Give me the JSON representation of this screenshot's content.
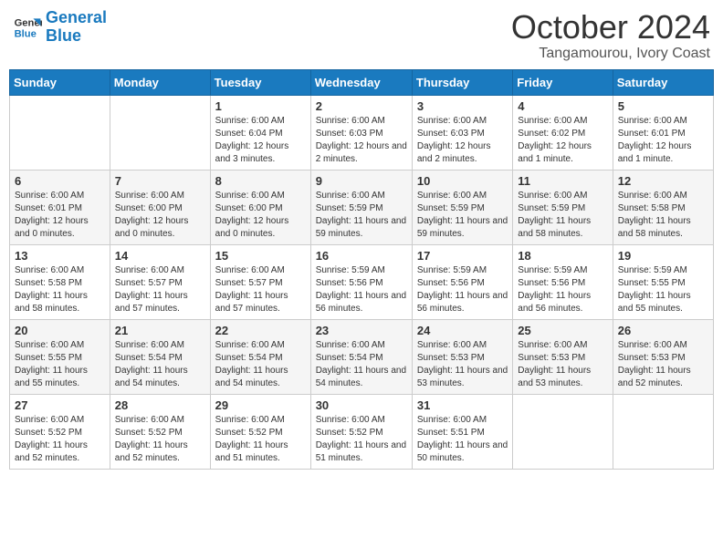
{
  "logo": {
    "line1": "General",
    "line2": "Blue"
  },
  "title": "October 2024",
  "location": "Tangamourou, Ivory Coast",
  "weekdays": [
    "Sunday",
    "Monday",
    "Tuesday",
    "Wednesday",
    "Thursday",
    "Friday",
    "Saturday"
  ],
  "weeks": [
    [
      {
        "day": "",
        "info": ""
      },
      {
        "day": "",
        "info": ""
      },
      {
        "day": "1",
        "info": "Sunrise: 6:00 AM\nSunset: 6:04 PM\nDaylight: 12 hours and 3 minutes."
      },
      {
        "day": "2",
        "info": "Sunrise: 6:00 AM\nSunset: 6:03 PM\nDaylight: 12 hours and 2 minutes."
      },
      {
        "day": "3",
        "info": "Sunrise: 6:00 AM\nSunset: 6:03 PM\nDaylight: 12 hours and 2 minutes."
      },
      {
        "day": "4",
        "info": "Sunrise: 6:00 AM\nSunset: 6:02 PM\nDaylight: 12 hours and 1 minute."
      },
      {
        "day": "5",
        "info": "Sunrise: 6:00 AM\nSunset: 6:01 PM\nDaylight: 12 hours and 1 minute."
      }
    ],
    [
      {
        "day": "6",
        "info": "Sunrise: 6:00 AM\nSunset: 6:01 PM\nDaylight: 12 hours and 0 minutes."
      },
      {
        "day": "7",
        "info": "Sunrise: 6:00 AM\nSunset: 6:00 PM\nDaylight: 12 hours and 0 minutes."
      },
      {
        "day": "8",
        "info": "Sunrise: 6:00 AM\nSunset: 6:00 PM\nDaylight: 12 hours and 0 minutes."
      },
      {
        "day": "9",
        "info": "Sunrise: 6:00 AM\nSunset: 5:59 PM\nDaylight: 11 hours and 59 minutes."
      },
      {
        "day": "10",
        "info": "Sunrise: 6:00 AM\nSunset: 5:59 PM\nDaylight: 11 hours and 59 minutes."
      },
      {
        "day": "11",
        "info": "Sunrise: 6:00 AM\nSunset: 5:59 PM\nDaylight: 11 hours and 58 minutes."
      },
      {
        "day": "12",
        "info": "Sunrise: 6:00 AM\nSunset: 5:58 PM\nDaylight: 11 hours and 58 minutes."
      }
    ],
    [
      {
        "day": "13",
        "info": "Sunrise: 6:00 AM\nSunset: 5:58 PM\nDaylight: 11 hours and 58 minutes."
      },
      {
        "day": "14",
        "info": "Sunrise: 6:00 AM\nSunset: 5:57 PM\nDaylight: 11 hours and 57 minutes."
      },
      {
        "day": "15",
        "info": "Sunrise: 6:00 AM\nSunset: 5:57 PM\nDaylight: 11 hours and 57 minutes."
      },
      {
        "day": "16",
        "info": "Sunrise: 5:59 AM\nSunset: 5:56 PM\nDaylight: 11 hours and 56 minutes."
      },
      {
        "day": "17",
        "info": "Sunrise: 5:59 AM\nSunset: 5:56 PM\nDaylight: 11 hours and 56 minutes."
      },
      {
        "day": "18",
        "info": "Sunrise: 5:59 AM\nSunset: 5:56 PM\nDaylight: 11 hours and 56 minutes."
      },
      {
        "day": "19",
        "info": "Sunrise: 5:59 AM\nSunset: 5:55 PM\nDaylight: 11 hours and 55 minutes."
      }
    ],
    [
      {
        "day": "20",
        "info": "Sunrise: 6:00 AM\nSunset: 5:55 PM\nDaylight: 11 hours and 55 minutes."
      },
      {
        "day": "21",
        "info": "Sunrise: 6:00 AM\nSunset: 5:54 PM\nDaylight: 11 hours and 54 minutes."
      },
      {
        "day": "22",
        "info": "Sunrise: 6:00 AM\nSunset: 5:54 PM\nDaylight: 11 hours and 54 minutes."
      },
      {
        "day": "23",
        "info": "Sunrise: 6:00 AM\nSunset: 5:54 PM\nDaylight: 11 hours and 54 minutes."
      },
      {
        "day": "24",
        "info": "Sunrise: 6:00 AM\nSunset: 5:53 PM\nDaylight: 11 hours and 53 minutes."
      },
      {
        "day": "25",
        "info": "Sunrise: 6:00 AM\nSunset: 5:53 PM\nDaylight: 11 hours and 53 minutes."
      },
      {
        "day": "26",
        "info": "Sunrise: 6:00 AM\nSunset: 5:53 PM\nDaylight: 11 hours and 52 minutes."
      }
    ],
    [
      {
        "day": "27",
        "info": "Sunrise: 6:00 AM\nSunset: 5:52 PM\nDaylight: 11 hours and 52 minutes."
      },
      {
        "day": "28",
        "info": "Sunrise: 6:00 AM\nSunset: 5:52 PM\nDaylight: 11 hours and 52 minutes."
      },
      {
        "day": "29",
        "info": "Sunrise: 6:00 AM\nSunset: 5:52 PM\nDaylight: 11 hours and 51 minutes."
      },
      {
        "day": "30",
        "info": "Sunrise: 6:00 AM\nSunset: 5:52 PM\nDaylight: 11 hours and 51 minutes."
      },
      {
        "day": "31",
        "info": "Sunrise: 6:00 AM\nSunset: 5:51 PM\nDaylight: 11 hours and 50 minutes."
      },
      {
        "day": "",
        "info": ""
      },
      {
        "day": "",
        "info": ""
      }
    ]
  ]
}
